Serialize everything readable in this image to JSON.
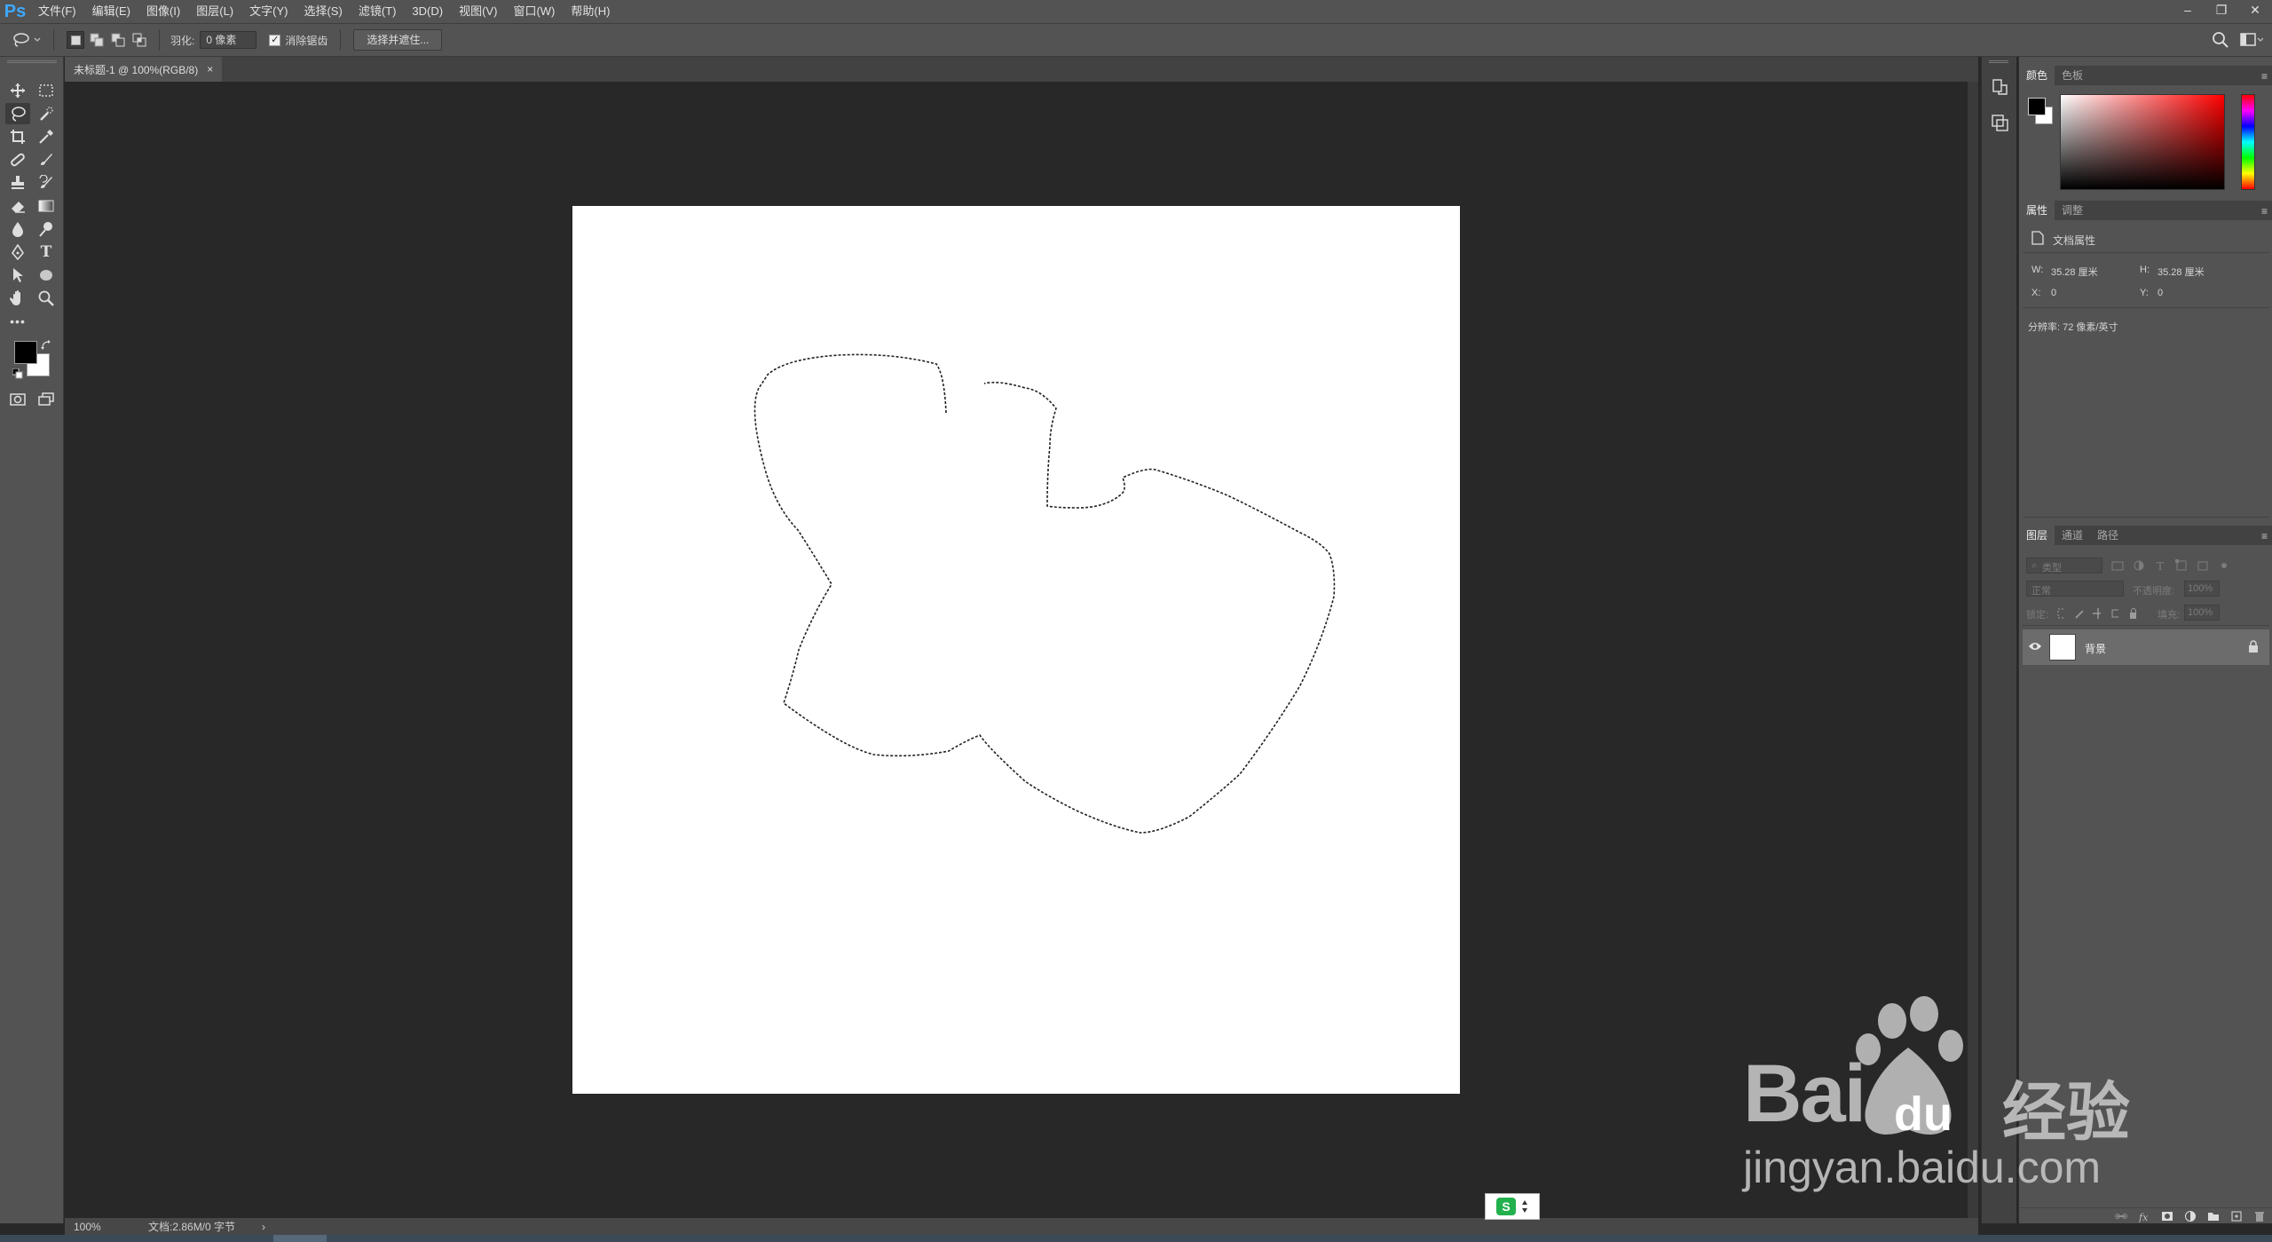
{
  "app": {
    "logo": "Ps"
  },
  "menu": [
    "文件(F)",
    "编辑(E)",
    "图像(I)",
    "图层(L)",
    "文字(Y)",
    "选择(S)",
    "滤镜(T)",
    "3D(D)",
    "视图(V)",
    "窗口(W)",
    "帮助(H)"
  ],
  "window_controls": [
    "–",
    "❐",
    "✕"
  ],
  "options": {
    "feather_label": "羽化:",
    "feather_value": "0 像素",
    "antialias_label": "消除锯齿",
    "select_mask_button": "选择并遮住..."
  },
  "document": {
    "tab_title": "未标题-1 @ 100%(RGB/8)",
    "close": "×"
  },
  "status": {
    "zoom": "100%",
    "doc_info": "文档:2.86M/0 字节",
    "arrow": "›"
  },
  "panels": {
    "color": {
      "tabs": [
        "颜色",
        "色板"
      ]
    },
    "properties": {
      "tabs": [
        "属性",
        "调整"
      ],
      "section": "文档属性",
      "w_label": "W:",
      "w_value": "35.28 厘米",
      "h_label": "H:",
      "h_value": "35.28 厘米",
      "x_label": "X:",
      "x_value": "0",
      "y_label": "Y:",
      "y_value": "0",
      "resolution": "分辨率: 72 像素/英寸"
    },
    "layers": {
      "tabs": [
        "图层",
        "通道",
        "路径"
      ],
      "filter_placeholder": "类型",
      "blend_mode": "正常",
      "opacity_label": "不透明度:",
      "opacity_value": "100%",
      "lock_label": "锁定:",
      "fill_label": "填充:",
      "fill_value": "100%",
      "layer_name": "背景"
    }
  },
  "watermark": {
    "brand": "Bai",
    "brand2": "du",
    "suffix": "经验",
    "url": "jingyan.baidu.com"
  },
  "ime": {
    "label": "S"
  },
  "colors": {
    "accent": "#3ea8ff",
    "panel": "#535353",
    "dark": "#282828"
  }
}
